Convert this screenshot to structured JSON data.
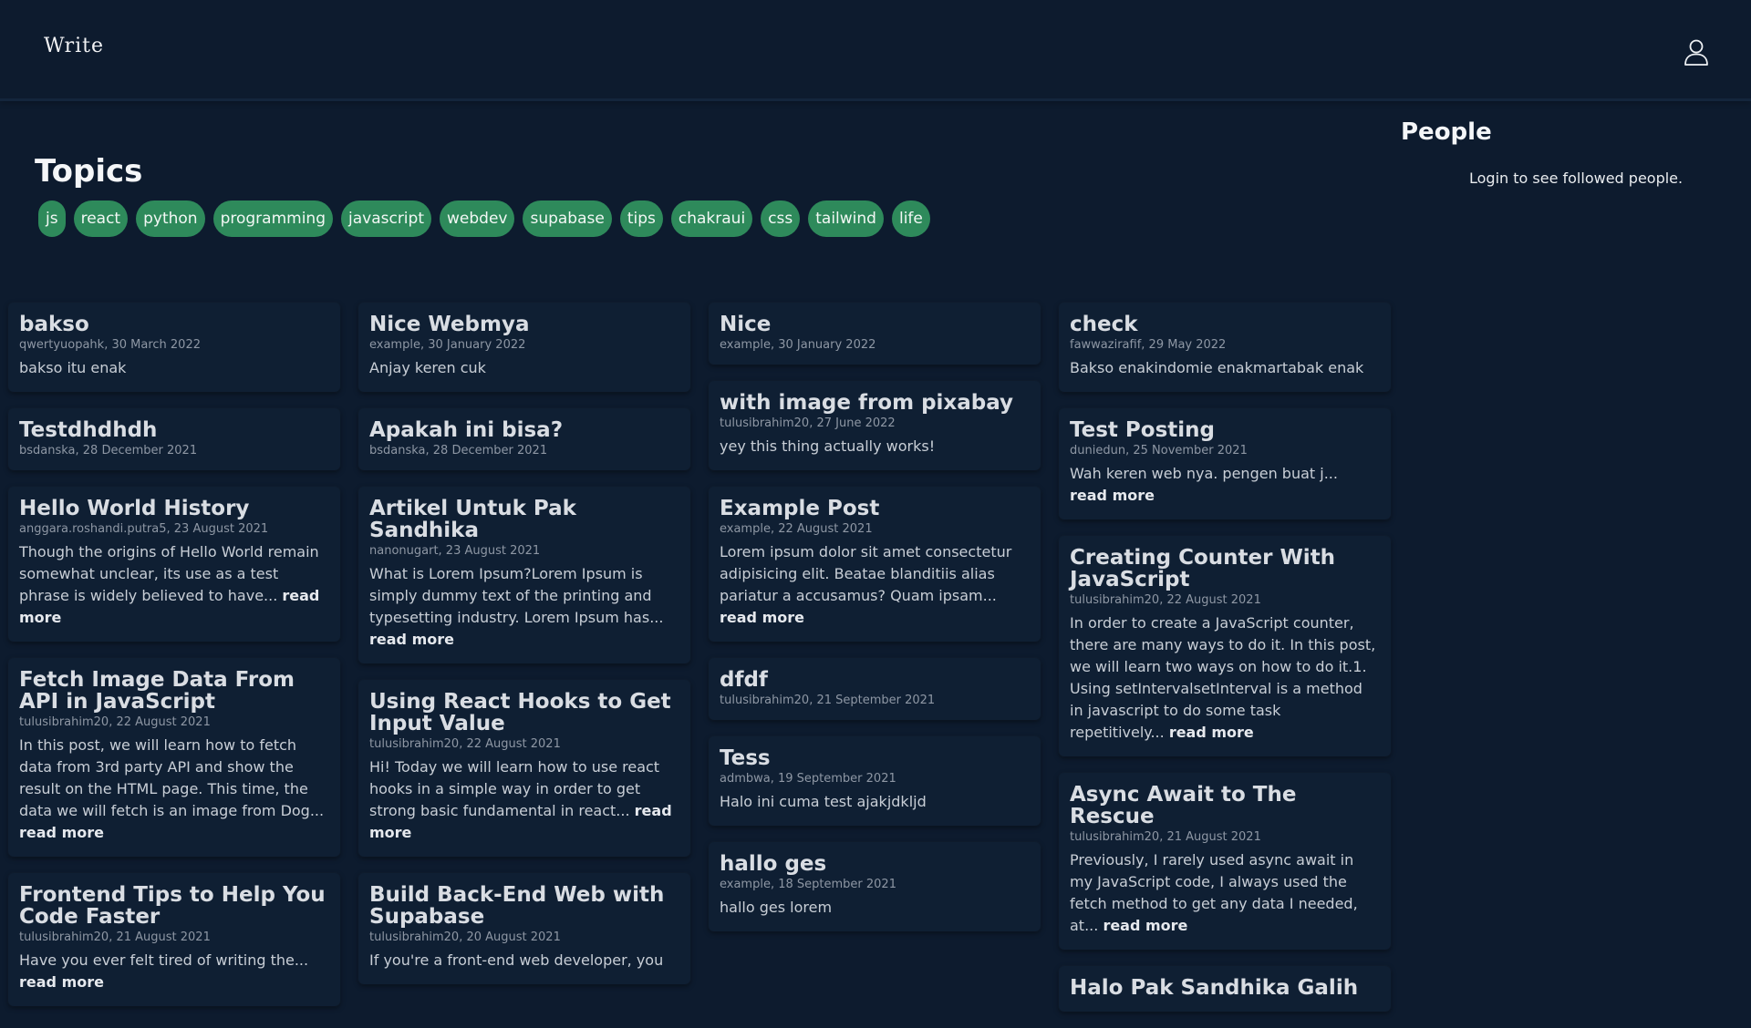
{
  "header": {
    "brand": "Write"
  },
  "topics": {
    "title": "Topics",
    "tags": [
      "js",
      "react",
      "python",
      "programming",
      "javascript",
      "webdev",
      "supabase",
      "tips",
      "chakraui",
      "css",
      "tailwind",
      "life"
    ]
  },
  "people": {
    "title": "People",
    "message": "Login to see followed people."
  },
  "read_more": "read more",
  "columns": [
    [
      {
        "title": "bakso",
        "meta": "qwertyuopahk, 30 March 2022",
        "excerpt": "bakso itu enak",
        "more": false
      },
      {
        "title": "Testdhdhdh",
        "meta": "bsdanska, 28 December 2021",
        "excerpt": "",
        "more": false
      },
      {
        "title": "Hello World History",
        "meta": "anggara.roshandi.putra5, 23 August 2021",
        "excerpt": "Though the origins of Hello World remain somewhat unclear, its use as a test phrase is widely believed to have...",
        "more": true
      },
      {
        "title": "Fetch Image Data From API in JavaScript",
        "meta": "tulusibrahim20, 22 August 2021",
        "excerpt": "In this post, we will learn how to fetch data from 3rd party API and show the result on the HTML page. This time, the data we will fetch is an image from Dog...",
        "more": true
      },
      {
        "title": "Frontend Tips to Help You Code Faster",
        "meta": "tulusibrahim20, 21 August 2021",
        "excerpt": "Have you ever felt tired of writing the...",
        "more": true
      }
    ],
    [
      {
        "title": "Nice Webmya",
        "meta": "example, 30 January 2022",
        "excerpt": "Anjay keren cuk",
        "more": false
      },
      {
        "title": "Apakah ini bisa?",
        "meta": "bsdanska, 28 December 2021",
        "excerpt": "",
        "more": false
      },
      {
        "title": "Artikel Untuk Pak Sandhika",
        "meta": "nanonugart, 23 August 2021",
        "excerpt": "What is Lorem Ipsum?Lorem Ipsum is simply dummy text of the printing and typesetting industry. Lorem Ipsum has...",
        "more": true
      },
      {
        "title": "Using React Hooks to Get Input Value",
        "meta": "tulusibrahim20, 22 August 2021",
        "excerpt": "Hi! Today we will learn how to use react hooks in a simple way in order to get strong basic fundamental in react...",
        "more": true
      },
      {
        "title": "Build Back-End Web with Supabase",
        "meta": "tulusibrahim20, 20 August 2021",
        "excerpt": "If you're a front-end web developer, you",
        "more": false
      }
    ],
    [
      {
        "title": "Nice",
        "meta": "example, 30 January 2022",
        "excerpt": "",
        "more": false
      },
      {
        "title": "with image from pixabay",
        "meta": "tulusibrahim20, 27 June 2022",
        "excerpt": "yey this thing actually works!",
        "more": false
      },
      {
        "title": "Example Post",
        "meta": "example, 22 August 2021",
        "excerpt": "Lorem ipsum dolor sit amet consectetur adipisicing elit. Beatae blanditiis alias pariatur a accusamus? Quam ipsam...",
        "more": true
      },
      {
        "title": "dfdf",
        "meta": "tulusibrahim20, 21 September 2021",
        "excerpt": "",
        "more": false
      },
      {
        "title": "Tess",
        "meta": "admbwa, 19 September 2021",
        "excerpt": "Halo ini cuma test ajakjdkljd",
        "more": false
      },
      {
        "title": "hallo ges",
        "meta": "example, 18 September 2021",
        "excerpt": "hallo ges lorem",
        "more": false
      }
    ],
    [
      {
        "title": "check",
        "meta": "fawwazirafif, 29 May 2022",
        "excerpt": "Bakso enakindomie enakmartabak enak",
        "more": false
      },
      {
        "title": "Test Posting",
        "meta": "duniedun, 25 November 2021",
        "excerpt": "Wah keren web nya. pengen buat j...",
        "more": true
      },
      {
        "title": "Creating Counter With JavaScript",
        "meta": "tulusibrahim20, 22 August 2021",
        "excerpt": "In order to create a JavaScript counter, there are many ways to do it. In this post, we will learn two ways on how to do it.1. Using setIntervalsetInterval is a method in javascript to do some task repetitively...",
        "more": true
      },
      {
        "title": "Async Await to The Rescue",
        "meta": "tulusibrahim20, 21 August 2021",
        "excerpt": "Previously, I rarely used async await in my JavaScript code, I always used the fetch method to get any data I needed, at...",
        "more": true
      },
      {
        "title": "Halo Pak Sandhika Galih",
        "meta": "",
        "excerpt": "",
        "more": false
      }
    ]
  ]
}
